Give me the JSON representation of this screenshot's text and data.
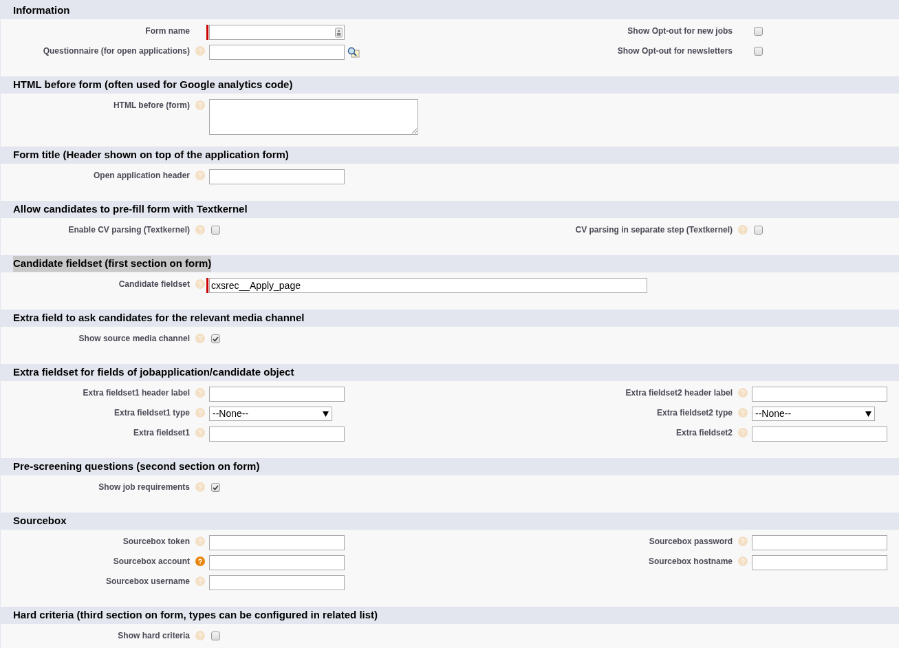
{
  "sections": [
    {
      "title": "Information",
      "highlighted": false,
      "left": [
        {
          "label": "Form name",
          "help_icon": false,
          "kind": "text",
          "required": true,
          "autofill_icon": true
        },
        {
          "label": "Questionnaire (for open applications)",
          "help_icon": true,
          "help_active": false,
          "kind": "lookup"
        }
      ],
      "right": [
        {
          "label": "Show Opt-out for new jobs",
          "help_icon": false,
          "kind": "checkbox",
          "checked": false
        },
        {
          "label": "Show Opt-out for newsletters",
          "help_icon": false,
          "kind": "checkbox",
          "checked": false
        }
      ]
    },
    {
      "title": "HTML before form (often used for Google analytics code)",
      "highlighted": false,
      "left": [
        {
          "label": "HTML before (form)",
          "help_icon": true,
          "help_active": false,
          "kind": "textarea"
        }
      ]
    },
    {
      "title": "Form title (Header shown on top of the application form)",
      "highlighted": false,
      "left": [
        {
          "label": "Open application header",
          "help_icon": true,
          "help_active": false,
          "kind": "text"
        }
      ]
    },
    {
      "title": "Allow candidates to pre-fill form with Textkernel",
      "highlighted": false,
      "left": [
        {
          "label": "Enable CV parsing (Textkernel)",
          "help_icon": true,
          "help_active": false,
          "kind": "checkbox",
          "checked": false
        }
      ],
      "right": [
        {
          "label": "CV parsing in separate step (Textkernel)",
          "help_icon": true,
          "help_active": false,
          "kind": "checkbox",
          "checked": false
        }
      ]
    },
    {
      "title": "Candidate fieldset (first section on form)",
      "highlighted": true,
      "left": [
        {
          "label": "Candidate fieldset",
          "help_icon": true,
          "help_active": false,
          "kind": "wide",
          "required": true,
          "value": "cxsrec__Apply_page"
        }
      ]
    },
    {
      "title": "Extra field to ask candidates for the relevant media channel",
      "highlighted": false,
      "left": [
        {
          "label": "Show source media channel",
          "help_icon": true,
          "help_active": false,
          "kind": "checkbox",
          "checked": true
        }
      ]
    },
    {
      "title": "Extra fieldset for fields of jobapplication/candidate object",
      "highlighted": false,
      "left": [
        {
          "label": "Extra fieldset1 header label",
          "help_icon": true,
          "help_active": false,
          "kind": "text"
        },
        {
          "label": "Extra fieldset1 type",
          "help_icon": true,
          "help_active": false,
          "kind": "select",
          "value": "--None--"
        },
        {
          "label": "Extra fieldset1",
          "help_icon": true,
          "help_active": false,
          "kind": "text"
        }
      ],
      "right": [
        {
          "label": "Extra fieldset2 header label",
          "help_icon": true,
          "help_active": false,
          "kind": "text"
        },
        {
          "label": "Extra fieldset2 type",
          "help_icon": true,
          "help_active": false,
          "kind": "select",
          "value": "--None--"
        },
        {
          "label": "Extra fieldset2",
          "help_icon": true,
          "help_active": false,
          "kind": "text"
        }
      ]
    },
    {
      "title": "Pre-screening questions (second section on form)",
      "highlighted": false,
      "left": [
        {
          "label": "Show job requirements",
          "help_icon": true,
          "help_active": false,
          "kind": "checkbox",
          "checked": true
        }
      ]
    },
    {
      "title": "Sourcebox",
      "highlighted": false,
      "left": [
        {
          "label": "Sourcebox token",
          "help_icon": true,
          "help_active": false,
          "kind": "text"
        },
        {
          "label": "Sourcebox account",
          "help_icon": true,
          "help_active": true,
          "kind": "text"
        },
        {
          "label": "Sourcebox username",
          "help_icon": true,
          "help_active": false,
          "kind": "text"
        }
      ],
      "right": [
        {
          "label": "Sourcebox password",
          "help_icon": true,
          "help_active": false,
          "kind": "text"
        },
        {
          "label": "Sourcebox hostname",
          "help_icon": true,
          "help_active": false,
          "kind": "text"
        }
      ]
    },
    {
      "title": "Hard criteria (third section on form, types can be configured in related list)",
      "highlighted": false,
      "left": [
        {
          "label": "Show hard criteria",
          "help_icon": true,
          "help_active": false,
          "kind": "checkbox",
          "checked": false
        }
      ]
    }
  ]
}
